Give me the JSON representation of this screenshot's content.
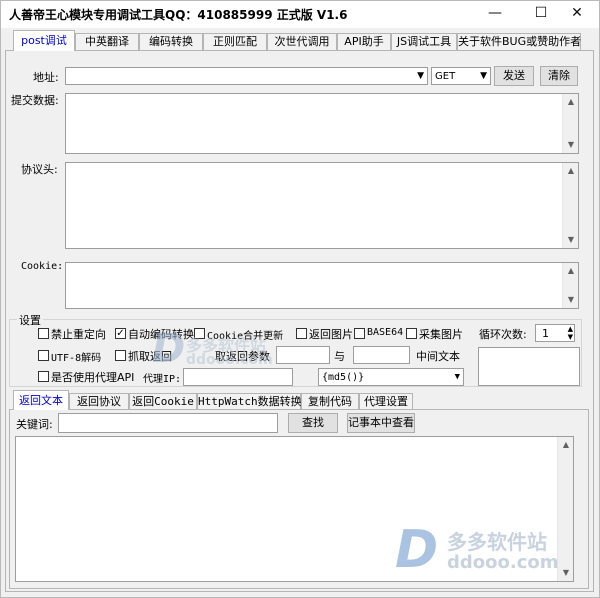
{
  "window": {
    "title": "人善帝王心模块专用调试工具QQ：410885999 正式版   V1.6",
    "minimize": "—",
    "maximize": "☐",
    "close": "✕"
  },
  "tabs": [
    "post调试",
    "中英翻译",
    "编码转换",
    "正则匹配",
    "次世代调用",
    "API助手",
    "JS调试工具",
    "关于软件BUG或赞助作者"
  ],
  "form": {
    "address_label": "地址:",
    "address_value": "",
    "method": "GET",
    "send": "发送",
    "clear": "清除",
    "submit_label": "提交数据:",
    "header_label": "协议头:",
    "cookie_label": "Cookie:"
  },
  "settings": {
    "group_label": "设置",
    "options": [
      {
        "label": "禁止重定向",
        "checked": false
      },
      {
        "label": "自动编码转换",
        "checked": true
      },
      {
        "label": "Cookie合并更新",
        "checked": false
      },
      {
        "label": "返回图片",
        "checked": false
      },
      {
        "label": "BASE64",
        "checked": false
      },
      {
        "label": "采集图片",
        "checked": false
      },
      {
        "label": "UTF-8解码",
        "checked": false
      },
      {
        "label": "抓取返回",
        "checked": false
      },
      {
        "label": "是否使用代理API",
        "checked": false
      }
    ],
    "loop_label": "循环次数:",
    "loop_value": "1",
    "extract_label": "取返回参数",
    "and_label": "与",
    "middle_label": "中间文本",
    "proxy_label": "代理IP:",
    "hash_option": "{md5()}"
  },
  "bottom_tabs": [
    "返回文本",
    "返回协议",
    "返回Cookie",
    "HttpWatch数据转换",
    "复制代码",
    "代理设置"
  ],
  "bottom": {
    "keyword_label": "关键词:",
    "find": "查找",
    "notepad": "记事本中查看"
  },
  "watermark": {
    "brand": "多多软件站",
    "url": "ddooo.com"
  },
  "colors": {
    "active_tab_text": "#0000d0",
    "panel_bg": "#f0f0f0"
  }
}
